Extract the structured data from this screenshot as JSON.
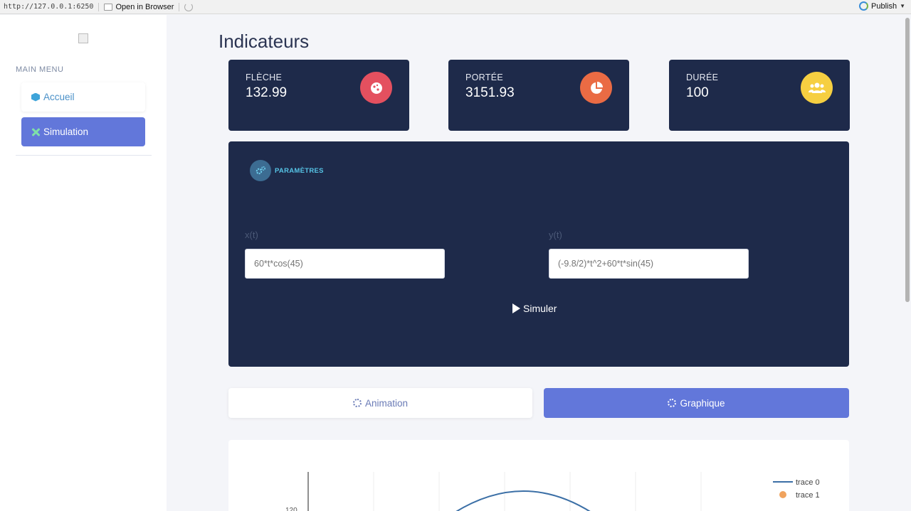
{
  "browser": {
    "url": "http://127.0.0.1:6250",
    "open_label": "Open in Browser",
    "publish_label": "Publish"
  },
  "sidebar": {
    "menu_title": "MAIN MENU",
    "items": [
      {
        "label": "Accueil",
        "icon": "cube-icon"
      },
      {
        "label": "Simulation",
        "icon": "tools-icon",
        "active": true
      }
    ]
  },
  "page": {
    "title": "Indicateurs"
  },
  "stats": [
    {
      "label": "FLÈCHE",
      "value": "132.99",
      "icon": "cookie-icon",
      "color": "#e4505f"
    },
    {
      "label": "PORTÉE",
      "value": "3151.93",
      "icon": "pie-chart-icon",
      "color": "#ea6b44"
    },
    {
      "label": "DURÉE",
      "value": "100",
      "icon": "users-icon",
      "color": "#f6cf41"
    }
  ],
  "params": {
    "header": "PARAMÈTRES",
    "x_label": "x(t)",
    "x_placeholder": "60*t*cos(45)",
    "y_label": "y(t)",
    "y_placeholder": "(-9.8/2)*t^2+60*t*sin(45)",
    "simulate_label": "Simuler"
  },
  "tabs": [
    {
      "label": "Animation",
      "icon": "gear-icon",
      "active": false
    },
    {
      "label": "Graphique",
      "icon": "gear-icon",
      "active": true
    }
  ],
  "chart_data": {
    "type": "line",
    "series": [
      {
        "name": "trace 0",
        "color": "#3b6fa6"
      },
      {
        "name": "trace 1",
        "color": "#f0a35e"
      }
    ],
    "y_tick_labels": [
      "120"
    ]
  }
}
